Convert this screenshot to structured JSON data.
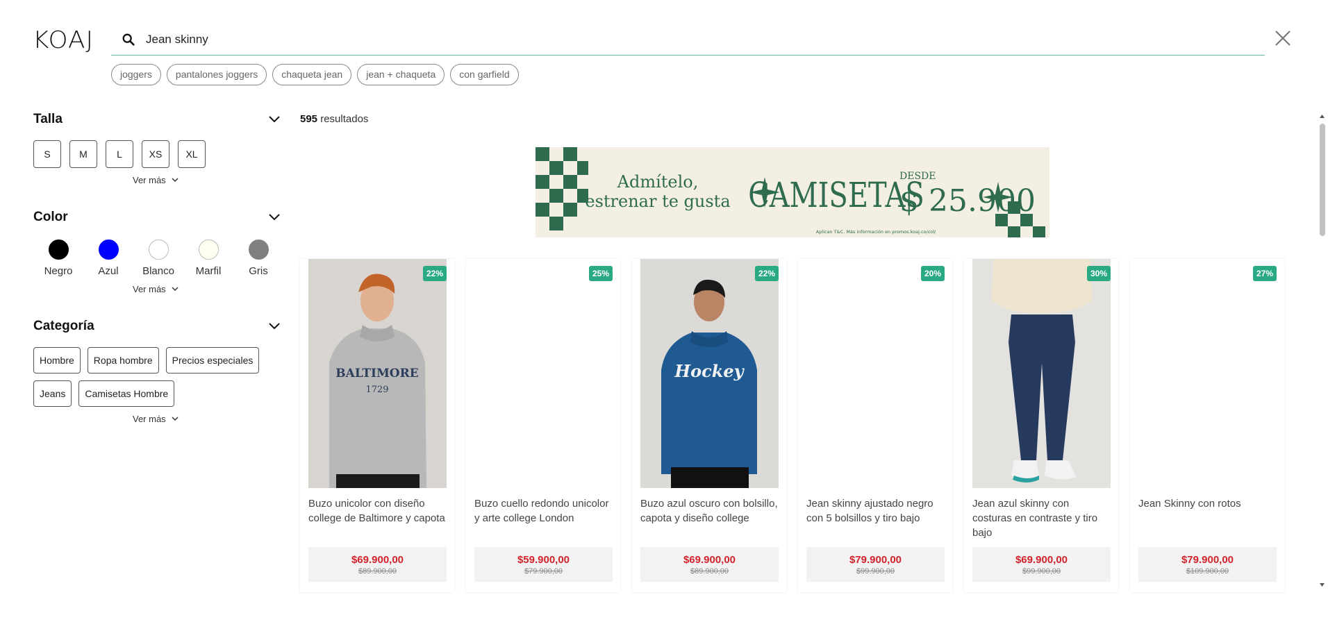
{
  "header": {
    "logo": "KOAJ",
    "search_value": "Jean skinny",
    "suggestions": [
      "joggers",
      "pantalones joggers",
      "chaqueta jean",
      "jean + chaqueta",
      "con garfield"
    ]
  },
  "filters": {
    "size": {
      "title": "Talla",
      "options": [
        "S",
        "M",
        "L",
        "XS",
        "XL"
      ],
      "more": "Ver más"
    },
    "color": {
      "title": "Color",
      "options": [
        {
          "label": "Negro",
          "hex": "#000000"
        },
        {
          "label": "Azul",
          "hex": "#0000ff"
        },
        {
          "label": "Blanco",
          "hex": "#ffffff"
        },
        {
          "label": "Marfil",
          "hex": "#fffff0"
        },
        {
          "label": "Gris",
          "hex": "#808080"
        }
      ],
      "more": "Ver más"
    },
    "category": {
      "title": "Categoría",
      "options": [
        "Hombre",
        "Ropa hombre",
        "Precios especiales",
        "Jeans",
        "Camisetas Hombre"
      ],
      "more": "Ver más"
    }
  },
  "results": {
    "count": "595",
    "label": "resultados"
  },
  "banner": {
    "line1": "Admítelo,",
    "line2": "estrenar te gusta",
    "product": "CAMISETAS",
    "from": "DESDE",
    "price": "$ 25.900",
    "legal": "Aplican T&C. Más información en promos.koaj.co/col/",
    "accent": "#2e6b4f"
  },
  "products": [
    {
      "discount": "22%",
      "name": "Buzo unicolor con diseño college de Baltimore y capota",
      "price": "$69.900,00",
      "old_price": "$89.900,00",
      "image": "gray-hoodie",
      "print": "BALTIMORE",
      "print_sub": "1729"
    },
    {
      "discount": "25%",
      "name": "Buzo cuello redondo unicolor y arte college London",
      "price": "$59.900,00",
      "old_price": "$79.900,00",
      "image": "empty"
    },
    {
      "discount": "22%",
      "name": "Buzo azul oscuro con bolsillo, capota y diseño college",
      "price": "$69.900,00",
      "old_price": "$89.900,00",
      "image": "blue-hoodie",
      "print": "Hockey"
    },
    {
      "discount": "20%",
      "name": "Jean skinny ajustado negro con 5 bolsillos y tiro bajo",
      "price": "$79.900,00",
      "old_price": "$99.900,00",
      "image": "empty"
    },
    {
      "discount": "30%",
      "name": "Jean azul skinny con costuras en contraste y tiro bajo",
      "price": "$69.900,00",
      "old_price": "$99.900,00",
      "image": "jeans"
    },
    {
      "discount": "27%",
      "name": "Jean Skinny con rotos",
      "price": "$79.900,00",
      "old_price": "$109.900,00",
      "image": "empty"
    }
  ],
  "colors": {
    "accent": "#2aa985",
    "price": "#d2232a",
    "search_underline": "#5fb89a"
  }
}
